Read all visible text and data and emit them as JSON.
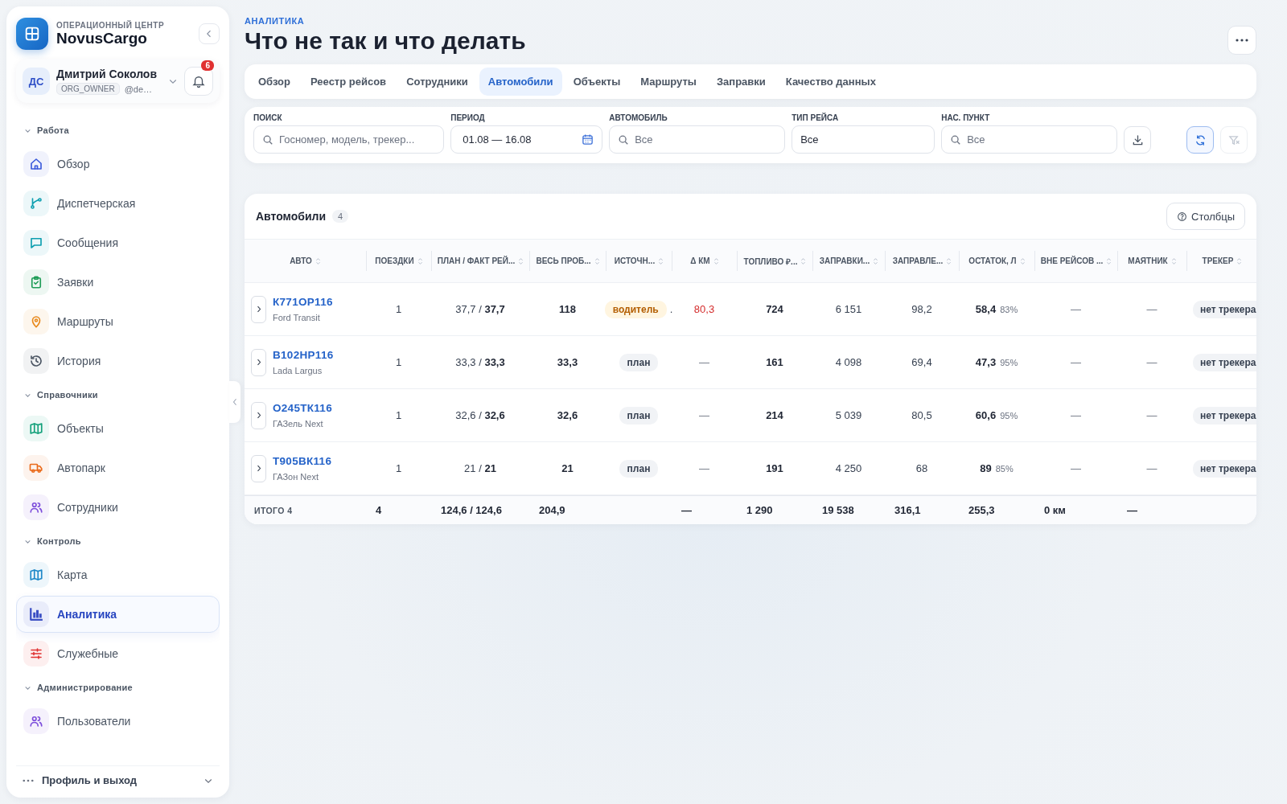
{
  "brand": {
    "eyebrow": "ОПЕРАЦИОННЫЙ ЦЕНТР",
    "name": "NovusCargo"
  },
  "user": {
    "initials": "ДС",
    "name": "Дмитрий Соколов",
    "role": "ORG_OWNER",
    "handle": "@de…",
    "notifications": "6"
  },
  "sidebar": {
    "sections": [
      {
        "title": "Работа",
        "expanded": true,
        "items": [
          {
            "label": "Обзор",
            "kind": "home",
            "color": "#3b5bdb",
            "selected": false
          },
          {
            "label": "Диспетчерская",
            "kind": "branch",
            "color": "#0e9fb0",
            "selected": false
          },
          {
            "label": "Сообщения",
            "kind": "chat",
            "color": "#0e9fb0",
            "selected": false
          },
          {
            "label": "Заявки",
            "kind": "clipboard",
            "color": "#1f9d57",
            "selected": false
          },
          {
            "label": "Маршруты",
            "kind": "pin",
            "color": "#e8891c",
            "selected": false
          },
          {
            "label": "История",
            "kind": "history",
            "color": "#4b5563",
            "selected": false
          }
        ]
      },
      {
        "title": "Справочники",
        "expanded": true,
        "items": [
          {
            "label": "Объекты",
            "kind": "map",
            "color": "#12a07a",
            "selected": false
          },
          {
            "label": "Автопарк",
            "kind": "truck",
            "color": "#ea6a1a",
            "selected": false
          },
          {
            "label": "Сотрудники",
            "kind": "users",
            "color": "#7c4ddb",
            "selected": false
          }
        ]
      },
      {
        "title": "Контроль",
        "expanded": true,
        "items": [
          {
            "label": "Карта",
            "kind": "map",
            "color": "#1e88c8",
            "selected": false
          },
          {
            "label": "Аналитика",
            "kind": "chart",
            "color": "#3b4fc4",
            "selected": true
          },
          {
            "label": "Служебные",
            "kind": "sliders",
            "color": "#e03131",
            "selected": false
          }
        ]
      },
      {
        "title": "Администрирование",
        "expanded": true,
        "items": [
          {
            "label": "Пользователи",
            "kind": "users",
            "color": "#7c4ddb",
            "selected": false
          }
        ]
      }
    ]
  },
  "sidebar_footer": {
    "label": "Профиль и выход"
  },
  "page": {
    "eyebrow": "АНАЛИТИКА",
    "title": "Что не так и что делать"
  },
  "tabs": [
    {
      "label": "Обзор",
      "selected": false
    },
    {
      "label": "Реестр рейсов",
      "selected": false
    },
    {
      "label": "Сотрудники",
      "selected": false
    },
    {
      "label": "Автомобили",
      "selected": true
    },
    {
      "label": "Объекты",
      "selected": false
    },
    {
      "label": "Маршруты",
      "selected": false
    },
    {
      "label": "Заправки",
      "selected": false
    },
    {
      "label": "Качество данных",
      "selected": false
    }
  ],
  "filters": [
    {
      "kind": "search",
      "label": "ПОИСК",
      "placeholder": "Госномер, модель, трекер..."
    },
    {
      "kind": "date",
      "label": "ПЕРИОД",
      "value": "01.08 — 16.08"
    },
    {
      "kind": "search",
      "label": "АВТОМОБИЛЬ",
      "placeholder": "Все"
    },
    {
      "kind": "select",
      "label": "ТИП РЕЙСА",
      "value": "Все"
    },
    {
      "kind": "search",
      "label": "НАС. ПУНКТ",
      "placeholder": "Все"
    }
  ],
  "filter_buttons": [
    {
      "kind": "download",
      "highlighted": false,
      "disabled": false
    },
    {
      "kind": "refresh",
      "highlighted": true,
      "disabled": false
    },
    {
      "kind": "clear",
      "highlighted": false,
      "disabled": true
    }
  ],
  "table": {
    "title": "Автомобили",
    "count": "4",
    "columns_button": "Столбцы",
    "columns": [
      "АВТО",
      "ПОЕЗДКИ",
      "ПЛАН / ФАКТ РЕЙ...",
      "ВЕСЬ ПРОБ...",
      "ИСТОЧН...",
      "Δ КМ",
      "ТОПЛИВО ₽...",
      "ЗАПРАВКИ...",
      "ЗАПРАВЛЕ...",
      "ОСТАТОК, Л",
      "ВНЕ РЕЙСОВ ...",
      "МАЯТНИК",
      "ТРЕКЕР"
    ],
    "rows": [
      {
        "plate": "К771ОР116",
        "model": "Ford Transit",
        "trips": "1",
        "plan_fact": "37,7 / **37,7**",
        "mileage": "118",
        "source": {
          "kind": "driver",
          "text": "водитель",
          "suffix": "."
        },
        "delta": {
          "text": "80,3",
          "alert": true
        },
        "fuel": "724",
        "refuel_sum": "6 151",
        "refueled": "98,2",
        "remain": "58,4",
        "remain_pct": "83%",
        "off_trip": "—",
        "pendulum": "—",
        "tracker": "нет трекера"
      },
      {
        "plate": "В102НР116",
        "model": "Lada Largus",
        "trips": "1",
        "plan_fact": "33,3 / **33,3**",
        "mileage": "33,3",
        "source": {
          "kind": "plan",
          "text": "план"
        },
        "delta": {
          "text": "—",
          "alert": false
        },
        "fuel": "161",
        "refuel_sum": "4 098",
        "refueled": "69,4",
        "remain": "47,3",
        "remain_pct": "95%",
        "off_trip": "—",
        "pendulum": "—",
        "tracker": "нет трекера"
      },
      {
        "plate": "О245ТК116",
        "model": "ГАЗель Next",
        "trips": "1",
        "plan_fact": "32,6 / **32,6**",
        "mileage": "32,6",
        "source": {
          "kind": "plan",
          "text": "план"
        },
        "delta": {
          "text": "—",
          "alert": false
        },
        "fuel": "214",
        "refuel_sum": "5 039",
        "refueled": "80,5",
        "remain": "60,6",
        "remain_pct": "95%",
        "off_trip": "—",
        "pendulum": "—",
        "tracker": "нет трекера"
      },
      {
        "plate": "Т905ВК116",
        "model": "ГАЗон Next",
        "trips": "1",
        "plan_fact": "21 / **21**",
        "mileage": "21",
        "source": {
          "kind": "plan",
          "text": "план"
        },
        "delta": {
          "text": "—",
          "alert": false
        },
        "fuel": "191",
        "refuel_sum": "4 250",
        "refueled": "68",
        "remain": "89",
        "remain_pct": "85%",
        "off_trip": "—",
        "pendulum": "—",
        "tracker": "нет трекера"
      }
    ],
    "totals": {
      "label": "ИТОГО 4",
      "trips": "4",
      "plan_fact": "124,6 / 124,6",
      "mileage": "204,9",
      "delta": "—",
      "fuel": "1 290",
      "refuel_sum": "19 538",
      "refueled": "316,1",
      "remain": "255,3",
      "off_trip": "0 км",
      "pendulum": "—"
    }
  }
}
